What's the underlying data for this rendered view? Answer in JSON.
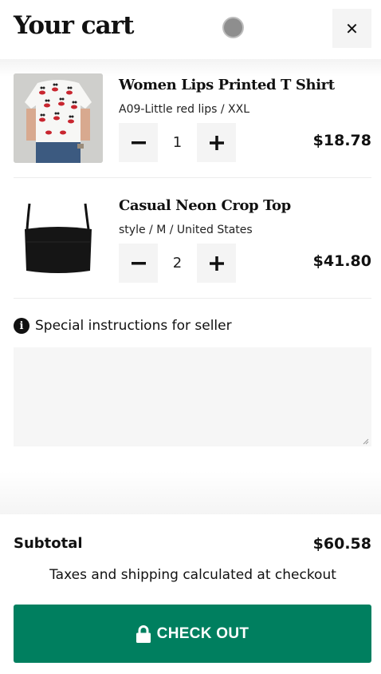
{
  "header": {
    "title": "Your cart",
    "close_icon": "close-icon"
  },
  "items": [
    {
      "name": "Women Lips Printed T Shirt",
      "variant": "A09-Little red lips / XXL",
      "quantity": "1",
      "price": "$18.78",
      "image_icon": "product-image-white-tshirt-lips"
    },
    {
      "name": "Casual Neon Crop Top",
      "variant": "style / M / United States",
      "quantity": "2",
      "price": "$41.80",
      "image_icon": "product-image-black-crop-top"
    }
  ],
  "instructions": {
    "label": "Special instructions for seller",
    "value": ""
  },
  "footer": {
    "subtotal_label": "Subtotal",
    "subtotal_value": "$60.58",
    "tax_note": "Taxes and shipping calculated at checkout",
    "checkout_label": "CHECK OUT"
  },
  "colors": {
    "checkout_bg": "#007f5f",
    "button_bg": "#f4f4f4"
  }
}
